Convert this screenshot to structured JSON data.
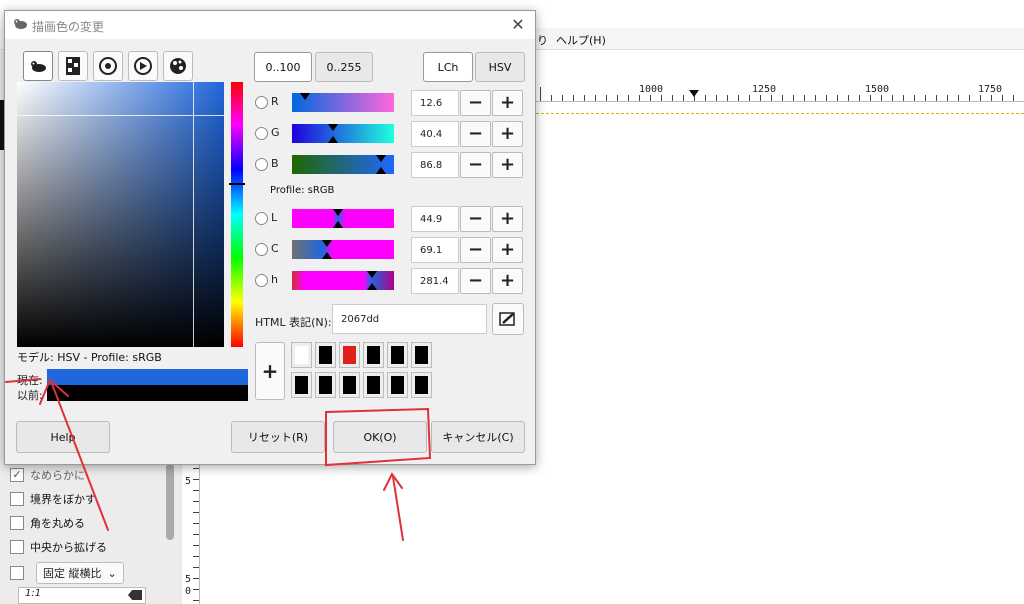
{
  "background_window": {
    "menu_help": "ヘルプ(H)",
    "menu_partial": "り",
    "ruler_labels": [
      "1000",
      "1250",
      "1500",
      "1750"
    ],
    "vruler_labels": [
      "5",
      "5",
      "0"
    ],
    "tool_options": {
      "smooth": "なめらかに",
      "feather": "境界をぼかす",
      "rounded": "角を丸める",
      "expand_center": "中央から拡げる",
      "fixed": "固定",
      "fixed_mode": "縦横比",
      "ratio": "1:1"
    }
  },
  "dialog": {
    "title": "描画色の変更",
    "close_glyph": "✕",
    "range_buttons": [
      "0..100",
      "0..255"
    ],
    "space_buttons": [
      "LCh",
      "HSV"
    ],
    "channels": [
      {
        "label": "R",
        "value": "12.6",
        "marker": 0.126,
        "gradient": "linear-gradient(to right,#0067dd,#ff67dd)",
        "marker_pos": "top"
      },
      {
        "label": "G",
        "value": "40.4",
        "marker": 0.404,
        "gradient": "linear-gradient(to right,#2000dd,#20ffdd)",
        "marker_pos": "both"
      },
      {
        "label": "B",
        "value": "86.8",
        "marker": 0.868,
        "gradient": "linear-gradient(to right,#206700,#2067ff)",
        "marker_pos": "both"
      },
      {
        "label": "L",
        "value": "44.9",
        "marker": 0.449,
        "gradient": "linear-gradient(to right,#ff00ff 0%,#ff00ff 40%,#2067dd 45%,#ff00ff 52%,#ff00ff 100%)",
        "marker_pos": "both"
      },
      {
        "label": "C",
        "value": "69.1",
        "marker": 0.345,
        "gradient": "linear-gradient(to right,#707070 0%,#2067dd 30%,#ff00ff 40%,#ff00ff 100%)",
        "marker_pos": "both"
      },
      {
        "label": "h",
        "value": "281.4",
        "marker": 0.78,
        "gradient": "linear-gradient(to right,#d03030 0%,#ff00ff 12%,#ff00ff 70%,#2067dd 78%,#b0008a 100%)",
        "marker_pos": "both"
      }
    ],
    "profile_text": "Profile: sRGB",
    "html_label": "HTML 表記(N):",
    "html_value": "2067dd",
    "model_text": "モデル: HSV - Profile: sRGB",
    "current_label": "現在:",
    "previous_label": "以前:",
    "add_button": "+",
    "colors": {
      "current": "#2067dd",
      "previous": "#000000"
    },
    "history": [
      "#ffffff",
      "#000000",
      "#e0201a",
      "#000000",
      "#000000",
      "#000000",
      "#000000",
      "#000000",
      "#000000",
      "#000000",
      "#000000",
      "#000000"
    ],
    "buttons": {
      "help": "Help",
      "reset": "リセット(R)",
      "ok": "OK(O)",
      "cancel": "キャンセル(C)"
    }
  },
  "annotation_color": "#e0303a"
}
